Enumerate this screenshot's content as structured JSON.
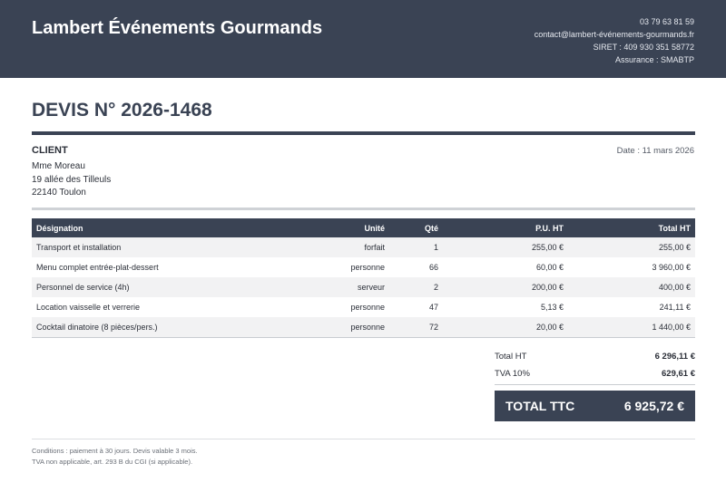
{
  "header": {
    "company": "Lambert Événements Gourmands",
    "phone": "03 79 63 81 59",
    "email": "contact@lambert-événements-gourmands.fr",
    "siret": "SIRET : 409 930 351 58772",
    "insurance": "Assurance : SMABTP"
  },
  "document": {
    "title": "DEVIS N° 2026-1468",
    "date": "Date : 11 mars 2026"
  },
  "client": {
    "label": "CLIENT",
    "name": "Mme Moreau",
    "address": "19 allée des Tilleuls",
    "city": "22140 Toulon"
  },
  "table": {
    "headers": [
      "Désignation",
      "Unité",
      "Qté",
      "P.U. HT",
      "Total HT"
    ],
    "rows": [
      [
        "Transport et installation",
        "forfait",
        "1",
        "255,00 €",
        "255,00 €"
      ],
      [
        "Menu complet entrée-plat-dessert",
        "personne",
        "66",
        "60,00 €",
        "3 960,00 €"
      ],
      [
        "Personnel de service (4h)",
        "serveur",
        "2",
        "200,00 €",
        "400,00 €"
      ],
      [
        "Location vaisselle et verrerie",
        "personne",
        "47",
        "5,13 €",
        "241,11 €"
      ],
      [
        "Cocktail dinatoire (8 pièces/pers.)",
        "personne",
        "72",
        "20,00 €",
        "1 440,00 €"
      ]
    ]
  },
  "totals": {
    "ht_label": "Total HT",
    "ht_value": "6 296,11 €",
    "tva_label": "TVA 10%",
    "tva_value": "629,61 €",
    "ttc_label": "TOTAL TTC",
    "ttc_value": "6 925,72 €"
  },
  "footer": {
    "line1": "Conditions : paiement à 30 jours. Devis valable 3 mois.",
    "line2": "TVA non applicable, art. 293 B du CGI (si applicable)."
  },
  "colors": {
    "primary": "#3a4354",
    "row_alt": "#f2f2f3"
  }
}
